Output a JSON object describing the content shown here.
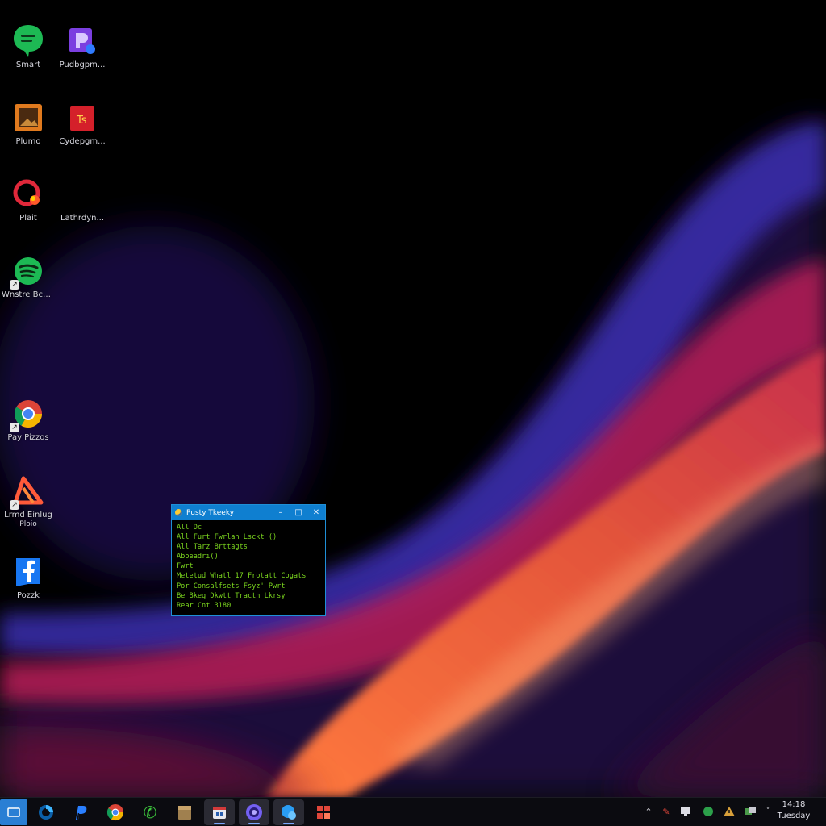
{
  "desktop": {
    "icons": [
      {
        "label": "Smart"
      },
      {
        "label": "Pudbgpm..."
      },
      {
        "label": "Plumo"
      },
      {
        "label": "Cydepgm..."
      },
      {
        "label": "Plait"
      },
      {
        "label": "Lathrdyn..."
      },
      {
        "label": "Wnstre Bcn..."
      },
      {
        "label": "Pay Pizzos"
      },
      {
        "label": "Lrmd Einlug",
        "label2": "Ploio"
      },
      {
        "label": "Pozzk"
      }
    ]
  },
  "terminal": {
    "title": "Pusty Tkeeky",
    "lines": [
      "All Dc",
      "All Furt Fwrlan Lsckt ()",
      "All Tarz Brttagts",
      "Aboeadri()",
      "Fwrt",
      "Metetud Whatl 17 Frotatt Cogats",
      "Por Consalfsets Fsyz' Pwrt",
      "Be Bkeg Dkwtt Tracth Lkrsy",
      "Rear Cnt 3180"
    ]
  },
  "taskbar": {
    "apps": [
      {
        "name": "start"
      },
      {
        "name": "edge"
      },
      {
        "name": "paypal"
      },
      {
        "name": "chrome"
      },
      {
        "name": "phone"
      },
      {
        "name": "files"
      },
      {
        "name": "calendar"
      },
      {
        "name": "viber"
      },
      {
        "name": "browser"
      },
      {
        "name": "apps-grid"
      }
    ],
    "clock": {
      "time": "14:18",
      "date": "Tuesday"
    }
  },
  "colors": {
    "terminal_text": "#7bd61e",
    "titlebar": "#0f7fd0",
    "taskbar": "#0b0b10"
  }
}
